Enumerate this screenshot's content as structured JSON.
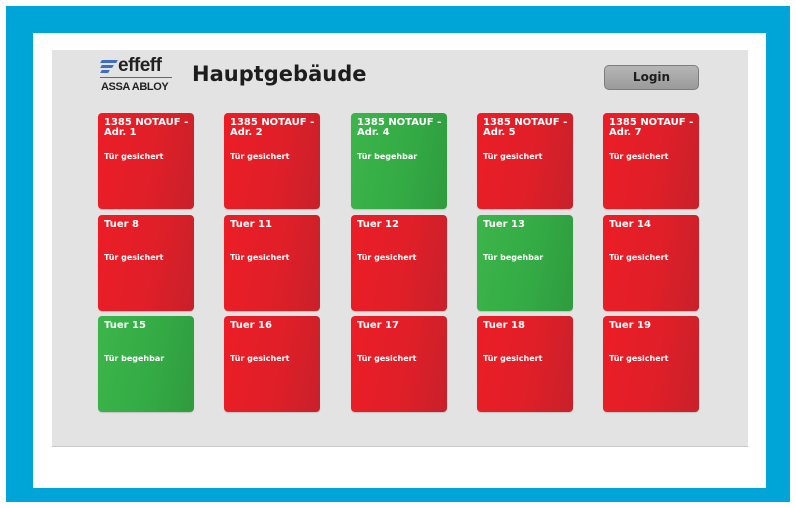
{
  "brand": {
    "top": "effeff",
    "bottom": "ASSA ABLOY"
  },
  "header": {
    "title": "Hauptgebäude",
    "login_label": "Login"
  },
  "colors": {
    "frame": "#00a5d8",
    "panel": "#e3e3e3",
    "secured": "#e01f28",
    "passable": "#34ab45"
  },
  "doors": [
    {
      "name": "1385 NOTAUF - Adr. 1",
      "status": "Tür gesichert",
      "state": "secured"
    },
    {
      "name": "1385 NOTAUF - Adr. 2",
      "status": "Tür gesichert",
      "state": "secured"
    },
    {
      "name": "1385 NOTAUF - Adr. 4",
      "status": "Tür begehbar",
      "state": "passable"
    },
    {
      "name": "1385 NOTAUF - Adr. 5",
      "status": "Tür gesichert",
      "state": "secured"
    },
    {
      "name": "1385 NOTAUF - Adr. 7",
      "status": "Tür gesichert",
      "state": "secured"
    },
    {
      "name": "Tuer 8",
      "status": "Tür gesichert",
      "state": "secured"
    },
    {
      "name": "Tuer 11",
      "status": "Tür gesichert",
      "state": "secured"
    },
    {
      "name": "Tuer 12",
      "status": "Tür gesichert",
      "state": "secured"
    },
    {
      "name": "Tuer 13",
      "status": "Tür begehbar",
      "state": "passable"
    },
    {
      "name": "Tuer 14",
      "status": "Tür gesichert",
      "state": "secured"
    },
    {
      "name": "Tuer 15",
      "status": "Tür begehbar",
      "state": "passable"
    },
    {
      "name": "Tuer 16",
      "status": "Tür gesichert",
      "state": "secured"
    },
    {
      "name": "Tuer 17",
      "status": "Tür gesichert",
      "state": "secured"
    },
    {
      "name": "Tuer 18",
      "status": "Tür gesichert",
      "state": "secured"
    },
    {
      "name": "Tuer 19",
      "status": "Tür gesichert",
      "state": "secured"
    }
  ]
}
